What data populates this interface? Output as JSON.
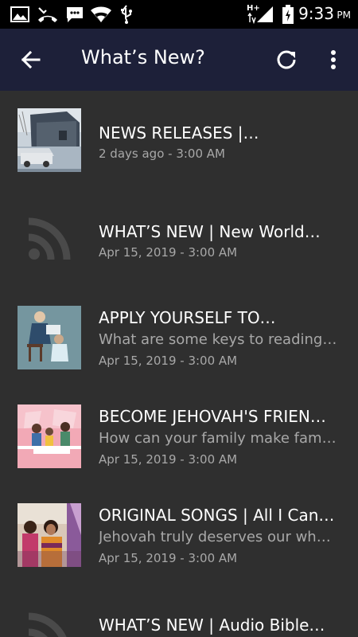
{
  "status_bar": {
    "time": "9:33",
    "ampm": "PM",
    "network_label": "H+",
    "icons": [
      "image-icon",
      "missed-call-icon",
      "message-icon",
      "wifi-icon",
      "usb-icon",
      "signal-icon",
      "battery-icon"
    ]
  },
  "app_bar": {
    "title": "What’s New?",
    "back_icon": "arrow-back-icon",
    "refresh_icon": "refresh-icon",
    "more_icon": "more-vert-icon"
  },
  "items": [
    {
      "title": "NEWS RELEASES |…",
      "subtitle": "",
      "date": "2 days ago - 3:00 AM",
      "thumb": "house-photo"
    },
    {
      "title": "WHAT’S NEW | New World…",
      "subtitle": "",
      "date": "Apr 15, 2019 - 3:00 AM",
      "thumb": "rss-icon"
    },
    {
      "title": "APPLY YOURSELF TO…",
      "subtitle": "What are some keys to reading…",
      "date": "Apr 15, 2019 - 3:00 AM",
      "thumb": "reading-illustration"
    },
    {
      "title": "BECOME JEHOVAH'S FRIEN…",
      "subtitle": "How can your family make famil…",
      "date": "Apr 15, 2019 - 3:00 AM",
      "thumb": "family-illustration"
    },
    {
      "title": "ORIGINAL SONGS | All I Can…",
      "subtitle": "Jehovah truly deserves our whol…",
      "date": "Apr 15, 2019 - 3:00 AM",
      "thumb": "women-photo"
    },
    {
      "title": "WHAT’S NEW | Audio Bible…",
      "subtitle": "",
      "date": "",
      "thumb": "rss-icon"
    }
  ],
  "colors": {
    "background": "#2f2f2f",
    "app_bar": "#1d2039",
    "status_bar": "#000000",
    "primary_text": "#ffffff",
    "secondary_text": "#a8a8a8",
    "rss_icon": "#4a4a4a"
  }
}
